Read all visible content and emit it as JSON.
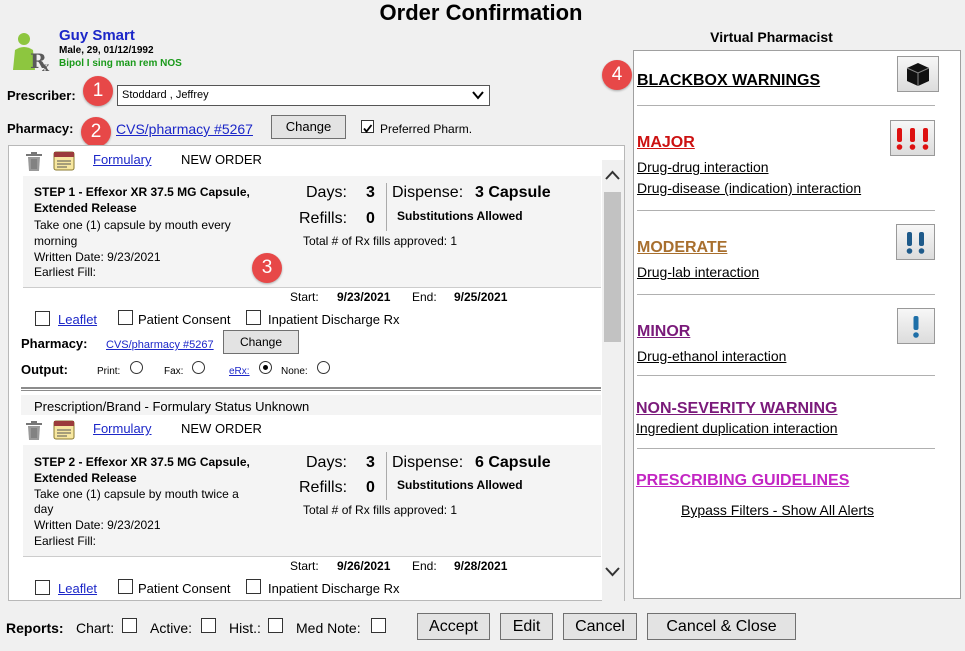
{
  "window": {
    "title": "Order Confirmation"
  },
  "patient": {
    "name": "Guy Smart",
    "info": "Male, 29, 01/12/1992",
    "diagnosis": "Bipol I sing man rem NOS"
  },
  "badges": [
    "1",
    "2",
    "3",
    "4"
  ],
  "prescriber": {
    "label": "Prescriber:",
    "value": "Stoddard , Jeffrey"
  },
  "pharmacy": {
    "label": "Pharmacy:",
    "name": "CVS/pharmacy #5267",
    "change_label": "Change",
    "preferred_label": "Preferred Pharm.",
    "preferred_checked": true
  },
  "orders": [
    {
      "formulary_label": "Formulary",
      "status": "NEW ORDER",
      "drug": "STEP 1 - Effexor XR 37.5 MG Capsule, Extended Release",
      "drug_line1": "STEP 1 - Effexor XR 37.5 MG Capsule,",
      "drug_line2": "Extended Release",
      "sig_line1": "Take one (1) capsule by mouth every",
      "sig_line2": "morning",
      "written": "Written Date: 9/23/2021",
      "earliest_fill": "Earliest Fill:",
      "days_label": "Days:",
      "days": "3",
      "refills_label": "Refills:",
      "refills": "0",
      "dispense_label": "Dispense:",
      "dispense": "3 Capsule",
      "substitutions": "Substitutions Allowed",
      "fills_approved": "Total # of Rx fills approved: 1",
      "start_label": "Start:",
      "start": "9/23/2021",
      "end_label": "End:",
      "end": "9/25/2021",
      "leaflet": "Leaflet",
      "consent": "Patient Consent",
      "discharge": "Inpatient Discharge Rx",
      "pharmacy_label": "Pharmacy:",
      "pharmacy_name": "CVS/pharmacy #5267",
      "change_label": "Change",
      "output_label": "Output:",
      "output_options": [
        "Print:",
        "Fax:",
        "eRx:",
        "None:"
      ],
      "output_selected": "eRx:"
    },
    {
      "header": "Prescription/Brand - Formulary Status Unknown",
      "formulary_label": "Formulary",
      "status": "NEW ORDER",
      "drug": "STEP 2 - Effexor XR 37.5 MG Capsule, Extended Release",
      "drug_line1": "STEP 2 - Effexor XR 37.5 MG Capsule,",
      "drug_line2": "Extended Release",
      "sig_line1": "Take one (1) capsule by mouth twice a",
      "sig_line2": "day",
      "written": "Written Date: 9/23/2021",
      "earliest_fill": "Earliest Fill:",
      "days_label": "Days:",
      "days": "3",
      "refills_label": "Refills:",
      "refills": "0",
      "dispense_label": "Dispense:",
      "dispense": "6 Capsule",
      "substitutions": "Substitutions Allowed",
      "fills_approved": "Total # of Rx fills approved: 1",
      "start_label": "Start:",
      "start": "9/26/2021",
      "end_label": "End:",
      "end": "9/28/2021",
      "leaflet": "Leaflet",
      "consent": "Patient Consent",
      "discharge": "Inpatient Discharge Rx"
    }
  ],
  "reports": {
    "label": "Reports:",
    "chart": "Chart:",
    "active": "Active:",
    "hist": "Hist.:",
    "med_note": "Med Note:"
  },
  "buttons": {
    "accept": "Accept",
    "edit": "Edit",
    "cancel": "Cancel",
    "cancel_close": "Cancel & Close"
  },
  "virtual_pharmacist": {
    "title": "Virtual Pharmacist",
    "blackbox": {
      "label": "BLACKBOX WARNINGS",
      "color": "#000000"
    },
    "major": {
      "label": "MAJOR",
      "color": "#cc1111",
      "items": [
        "Drug-drug interaction",
        "Drug-disease (indication) interaction"
      ]
    },
    "moderate": {
      "label": "MODERATE",
      "color": "#a86f2e",
      "items": [
        "Drug-lab interaction"
      ]
    },
    "minor": {
      "label": "MINOR",
      "color": "#7a1a7a",
      "items": [
        "Drug-ethanol interaction"
      ]
    },
    "nonseverity": {
      "label": "NON-SEVERITY WARNING",
      "color": "#7a1a7a",
      "items": [
        "Ingredient duplication interaction"
      ]
    },
    "guidelines": {
      "label": "PRESCRIBING GUIDELINES",
      "color": "#c326c3"
    },
    "bypass": "Bypass Filters - Show All Alerts"
  }
}
